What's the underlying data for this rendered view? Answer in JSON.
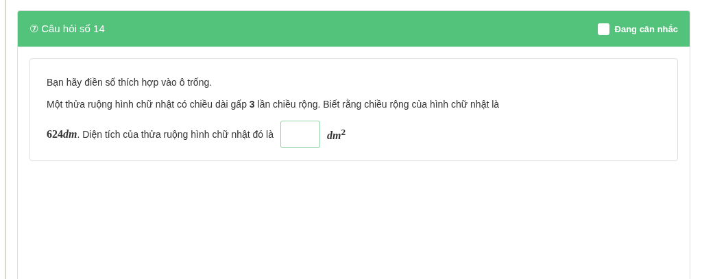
{
  "header": {
    "icon": "⑦",
    "title": "Câu hỏi số 14",
    "flag": {
      "label": "Đang cân nhắc",
      "checked": false
    }
  },
  "question": {
    "instruction": "Bạn hãy điền số thích hợp vào ô trống.",
    "line_1": "Một thửa ruộng hình chữ nhật có chiều dài gấp **3** lần chiều rộng. Biết rằng chiều rộng của hình chữ nhật là",
    "measure": {
      "number": "624",
      "unit": "dm"
    },
    "line_2": ". Diện tích của thửa ruộng hình chữ nhật đó là",
    "answer_unit": {
      "base": "dm",
      "power": "2"
    }
  }
}
